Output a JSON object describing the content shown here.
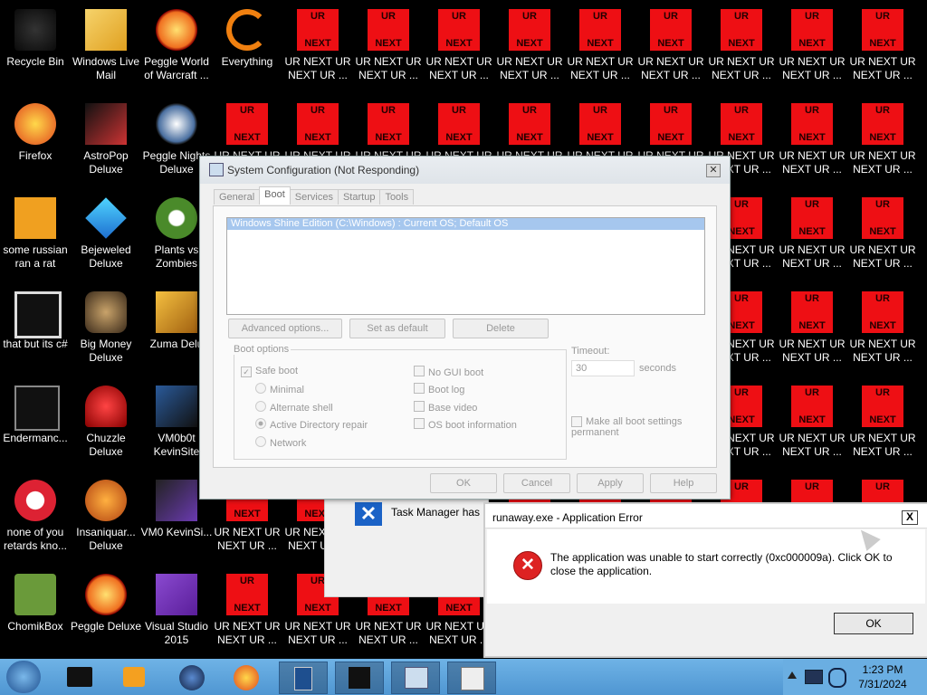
{
  "desktop": {
    "column1": [
      "Recycle Bin",
      "Firefox",
      "some russian ran a rat",
      "that but its c#",
      "Endermanc...",
      "none of you retards kno...",
      "ChomikBox"
    ],
    "column2": [
      "Windows Live Mail",
      "AstroPop Deluxe",
      "Bejeweled Deluxe",
      "Big Money Deluxe",
      "Chuzzle Deluxe",
      "Insaniquar... Deluxe",
      "Peggle Deluxe"
    ],
    "column3": [
      "Peggle World of Warcraft ...",
      "Peggle Nights Deluxe",
      "Plants vs Zombies",
      "Zuma Delu",
      "VM0b0t KevinSite",
      "VM0 KevinSi...",
      "Visual Studio 2015"
    ],
    "column4_top": "Everything",
    "ur_icon": {
      "top": "UR",
      "bottom": "NEXT",
      "label": "UR NEXT UR NEXT UR ...",
      "label_line1": "UR NEXT UR",
      "label_line2": "NEXT UR ..."
    }
  },
  "system_config": {
    "title": "System Configuration (Not Responding)",
    "tabs": [
      "General",
      "Boot",
      "Services",
      "Startup",
      "Tools"
    ],
    "active_tab": "Boot",
    "os_entry": "Windows Shine Edition (C:\\Windows) : Current OS; Default OS",
    "buttons": {
      "advanced": "Advanced options...",
      "set_default": "Set as default",
      "delete": "Delete"
    },
    "boot_options_label": "Boot options",
    "safe_boot": "Safe boot",
    "minimal": "Minimal",
    "alternate_shell": "Alternate shell",
    "ad_repair": "Active Directory repair",
    "network": "Network",
    "no_gui": "No GUI boot",
    "boot_log": "Boot log",
    "base_video": "Base video",
    "os_boot_info": "OS boot information",
    "timeout_label": "Timeout:",
    "timeout_value": "30",
    "seconds": "seconds",
    "make_permanent": "Make all boot settings permanent",
    "ok": "OK",
    "cancel": "Cancel",
    "apply": "Apply",
    "help": "Help"
  },
  "task_manager": {
    "text": "Task Manager has b"
  },
  "error_dialog": {
    "title": "runaway.exe - Application Error",
    "message": "The application was unable to start correctly (0xc000009a). Click OK to close the application.",
    "ok": "OK",
    "close": "X"
  },
  "taskbar": {
    "time": "1:23 PM",
    "date": "7/31/2024"
  }
}
